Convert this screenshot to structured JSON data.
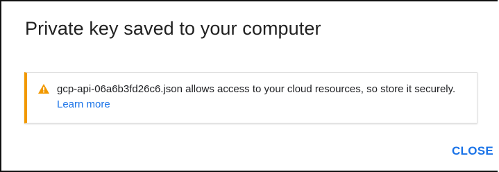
{
  "dialog": {
    "title": "Private key saved to your computer",
    "warning": {
      "icon": "warning-icon",
      "icon_color": "#f29900",
      "text": "gcp-api-06a6b3fd26c6.json allows access to your cloud resources, so store it securely. ",
      "link_label": "Learn more"
    },
    "close_label": "CLOSE",
    "accent_color": "#1a73e8"
  }
}
